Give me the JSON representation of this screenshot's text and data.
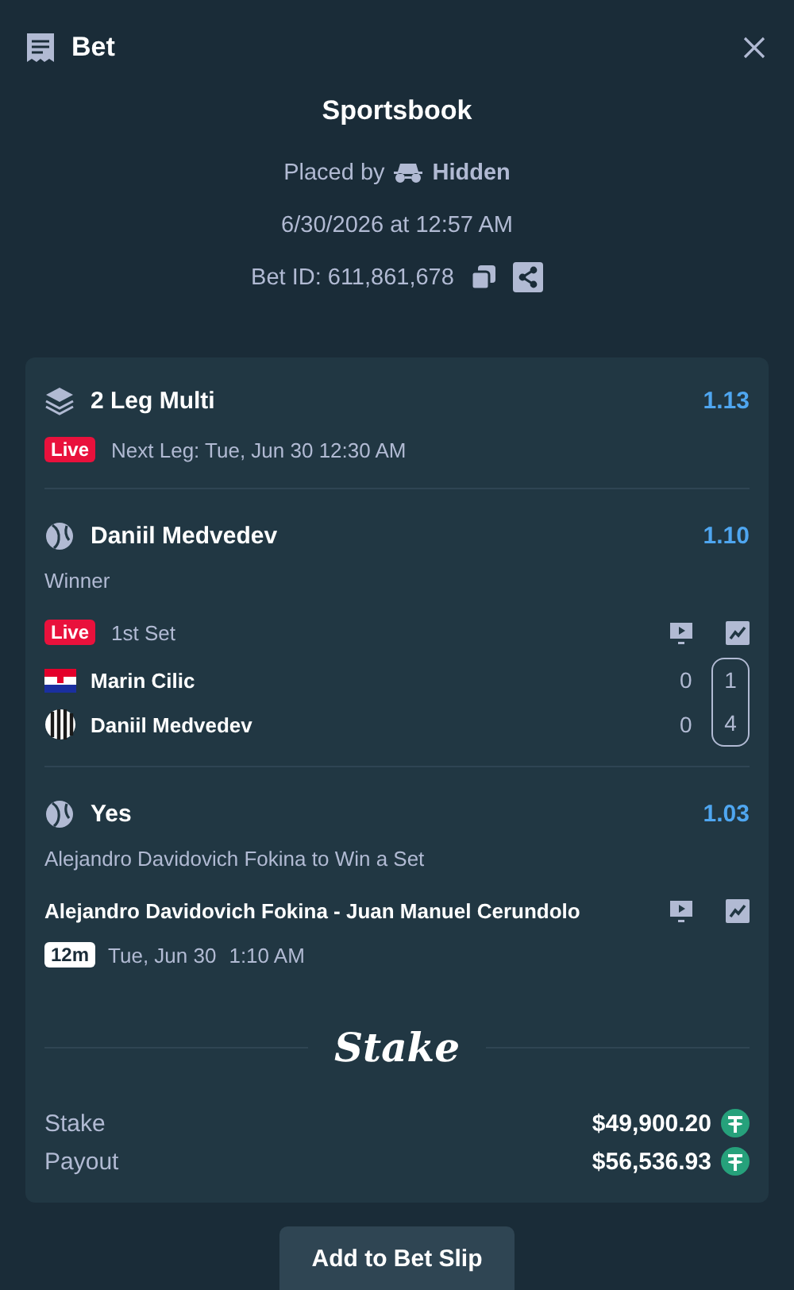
{
  "header": {
    "title": "Bet"
  },
  "summary": {
    "title": "Sportsbook",
    "placed_by": "Placed by",
    "user": "Hidden",
    "date": "6/30/2026 at 12:57 AM",
    "bet_id": "Bet ID: 611,861,678"
  },
  "multi": {
    "title": "2 Leg Multi",
    "odds": "1.13",
    "badge": "Live",
    "next_leg": "Next Leg: Tue, Jun 30 12:30 AM"
  },
  "legs": [
    {
      "kind": "live",
      "selection": "Daniil Medvedev",
      "odds": "1.10",
      "market": "Winner",
      "badge": "Live",
      "status": "1st Set",
      "players": [
        {
          "kind": "flag",
          "name": "Marin Cilic",
          "games": "0",
          "sets": "1"
        },
        {
          "kind": "stripes",
          "name": "Daniil Medvedev",
          "games": "0",
          "sets": "4"
        }
      ]
    },
    {
      "kind": "upcoming",
      "selection": "Yes",
      "odds": "1.03",
      "market": "Alejandro Davidovich Fokina to Win a Set",
      "event": "Alejandro Davidovich Fokina - Juan Manuel Cerundolo",
      "badge": "12m",
      "date": "Tue, Jun 30",
      "time": "1:10 AM"
    }
  ],
  "brand": "Stake",
  "totals": [
    {
      "label": "Stake",
      "amount": "$49,900.20"
    },
    {
      "label": "Payout",
      "amount": "$56,536.93"
    }
  ],
  "button": "Add to Bet Slip"
}
